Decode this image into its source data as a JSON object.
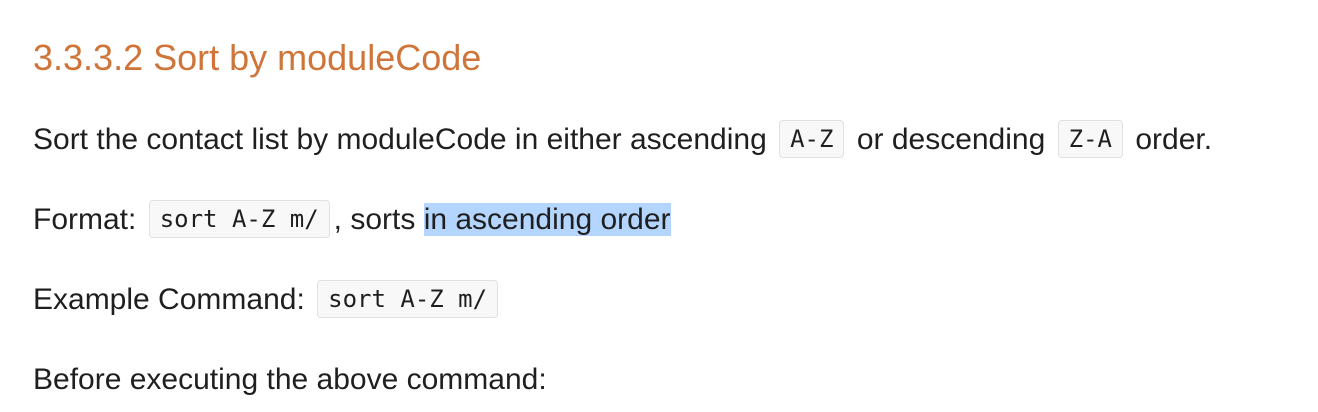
{
  "section": {
    "heading": "3.3.3.2 Sort by moduleCode"
  },
  "description": {
    "text_before": "Sort the contact list by moduleCode in either ascending",
    "code_asc": "A-Z",
    "text_middle": "or descending",
    "code_desc": "Z-A",
    "text_after": "order."
  },
  "format": {
    "label": "Format:",
    "code": "sort A-Z m/",
    "text_plain": ", sorts",
    "text_selected": "in ascending order"
  },
  "example": {
    "label": "Example Command:",
    "code": "sort A-Z m/"
  },
  "before": {
    "text": "Before executing the above command:"
  },
  "colors": {
    "heading": "#d0753a",
    "selection": "#b4d5fe"
  }
}
